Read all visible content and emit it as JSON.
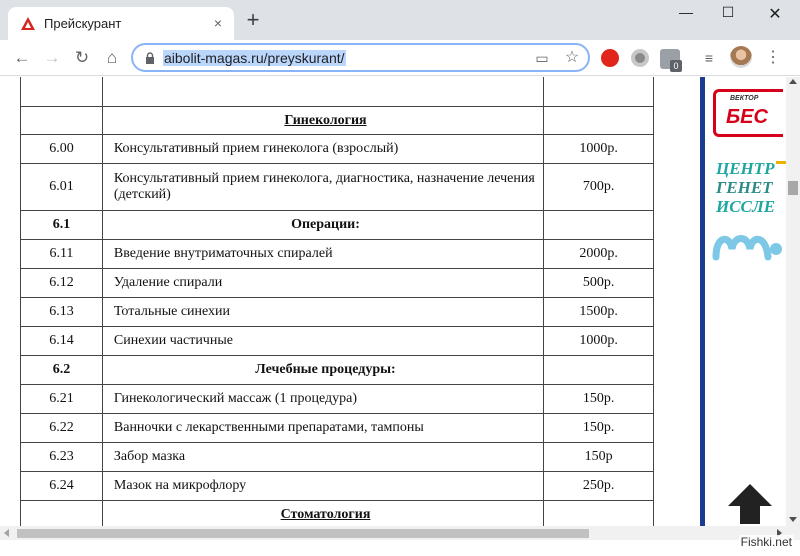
{
  "browser": {
    "tab_title": "Прейскурант",
    "new_tab_label": "+",
    "url": "aibolit-magas.ru/preyskurant/",
    "ext_badge": "0"
  },
  "icons": {
    "tab_favicon": "red-triangle-logo",
    "close": "×",
    "minimize": "—",
    "maximize": "☐",
    "window_close": "✕",
    "back": "←",
    "forward": "→",
    "reload": "↻",
    "home": "⌂",
    "cast": "▭",
    "star": "☆",
    "media": "≡",
    "menu": "⋮"
  },
  "colors": {
    "accent_blue": "#1a3b8f",
    "brand_red": "#d7001a",
    "teal": "#1fa6a0"
  },
  "table": {
    "rows": [
      {
        "type": "blank",
        "code": "",
        "name": "",
        "price": ""
      },
      {
        "type": "heading",
        "code": "",
        "name": "Гинекология",
        "price": ""
      },
      {
        "type": "item",
        "code": "6.00",
        "name": "Консультативный прием гинеколога (взрослый)",
        "price": "1000р."
      },
      {
        "type": "item",
        "code": "6.01",
        "name": "Консультативный прием гинеколога, диагностика, назначение лечения (детский)",
        "price": "700р."
      },
      {
        "type": "section",
        "code": "6.1",
        "name": "Операции:",
        "price": ""
      },
      {
        "type": "item",
        "code": "6.11",
        "name": "Введение внутриматочных спиралей",
        "price": "2000р."
      },
      {
        "type": "item",
        "code": "6.12",
        "name": "Удаление спирали",
        "price": "500р."
      },
      {
        "type": "item",
        "code": "6.13",
        "name": "Тотальные синехии",
        "price": "1500р."
      },
      {
        "type": "item",
        "code": "6.14",
        "name": "Синехии частичные",
        "price": "1000р."
      },
      {
        "type": "section",
        "code": "6.2",
        "name": "Лечебные процедуры:",
        "price": ""
      },
      {
        "type": "item",
        "code": "6.21",
        "name": "Гинекологический массаж  (1 процедура)",
        "price": "150р."
      },
      {
        "type": "item",
        "code": "6.22",
        "name": "Ванночки с лекарственными препаратами, тампоны",
        "price": "150р."
      },
      {
        "type": "item",
        "code": "6.23",
        "name": "Забор мазка",
        "price": "150р"
      },
      {
        "type": "item",
        "code": "6.24",
        "name": "Мазок на микрофлору",
        "price": "250р."
      },
      {
        "type": "heading",
        "code": "",
        "name": "Стоматология",
        "price": ""
      }
    ]
  },
  "ads": {
    "bes_top": "ВЕКТОР",
    "bes_main": "БЕС",
    "gen_line_1": "ЦЕНТР",
    "gen_line_2": "ГЕНЕТ",
    "gen_line_3": "ИССЛЕ"
  },
  "watermark": "Fishki.net"
}
